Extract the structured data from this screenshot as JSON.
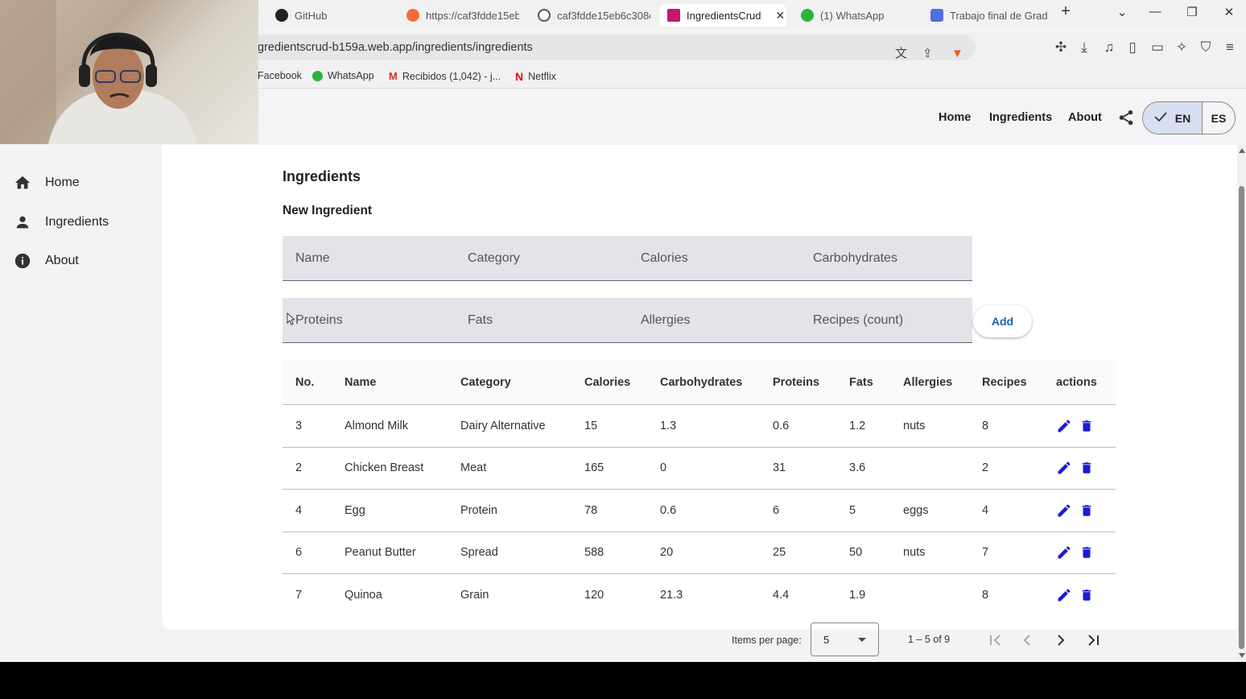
{
  "browser": {
    "tabs": [
      {
        "label": "GitHub",
        "icon": "github-icon"
      },
      {
        "label": "https://caf3fdde15eb",
        "icon": "firebase-icon"
      },
      {
        "label": "caf3fdde15eb6c308e",
        "icon": "globe-icon"
      },
      {
        "label": "IngredientsCrud",
        "icon": "angular-icon",
        "active": true
      },
      {
        "label": "(1) WhatsApp",
        "icon": "whatsapp-icon"
      },
      {
        "label": "Trabajo final de Grad",
        "icon": "doc-icon"
      }
    ],
    "new_tab": "+",
    "url": "gredientscrud-b159a.web.app/ingredients/ingredients",
    "bookmarks": [
      {
        "label": "Facebook"
      },
      {
        "label": "WhatsApp"
      },
      {
        "label": "Recibidos (1,042) - j..."
      },
      {
        "label": "Netflix"
      }
    ]
  },
  "appbar": {
    "links": [
      "Home",
      "Ingredients",
      "About"
    ],
    "lang": {
      "en": "EN",
      "es": "ES"
    }
  },
  "sidebar": {
    "items": [
      {
        "label": "Home",
        "icon": "home-icon"
      },
      {
        "label": "Ingredients",
        "icon": "person-icon"
      },
      {
        "label": "About",
        "icon": "info-icon"
      }
    ]
  },
  "page": {
    "title": "Ingredients",
    "form_title": "New Ingredient",
    "form_fields": [
      "Name",
      "Category",
      "Calories",
      "Carbohydrates",
      "Proteins",
      "Fats",
      "Allergies",
      "Recipes (count)"
    ],
    "add_label": "Add"
  },
  "table": {
    "headers": [
      "No.",
      "Name",
      "Category",
      "Calories",
      "Carbohydrates",
      "Proteins",
      "Fats",
      "Allergies",
      "Recipes",
      "actions"
    ],
    "rows": [
      [
        "3",
        "Almond Milk",
        "Dairy Alternative",
        "15",
        "1.3",
        "0.6",
        "1.2",
        "nuts",
        "8"
      ],
      [
        "2",
        "Chicken Breast",
        "Meat",
        "165",
        "0",
        "31",
        "3.6",
        "",
        "2"
      ],
      [
        "4",
        "Egg",
        "Protein",
        "78",
        "0.6",
        "6",
        "5",
        "eggs",
        "4"
      ],
      [
        "6",
        "Peanut Butter",
        "Spread",
        "588",
        "20",
        "25",
        "50",
        "nuts",
        "7"
      ],
      [
        "7",
        "Quinoa",
        "Grain",
        "120",
        "21.3",
        "4.4",
        "1.9",
        "",
        "8"
      ]
    ]
  },
  "paginator": {
    "items_per_page_label": "Items per page:",
    "page_size": "5",
    "range": "1 – 5 of 9"
  },
  "colors": {
    "accent": "#1d5fb4",
    "action_icon": "#1a1ad6",
    "field_bg": "#e3e3ea"
  }
}
